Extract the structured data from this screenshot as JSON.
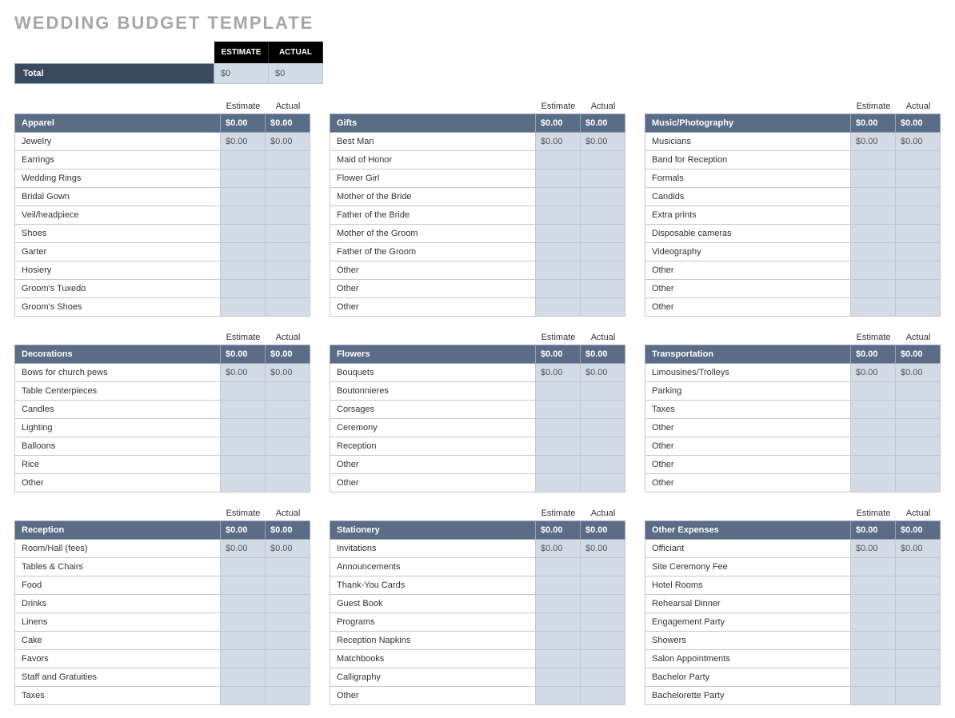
{
  "title": "WEDDING BUDGET TEMPLATE",
  "header": {
    "estimate": "ESTIMATE",
    "actual": "ACTUAL"
  },
  "total": {
    "label": "Total",
    "estimate": "$0",
    "actual": "$0"
  },
  "colLabels": {
    "estimate": "Estimate",
    "actual": "Actual"
  },
  "columns": [
    [
      {
        "name": "Apparel",
        "estimate": "$0.00",
        "actual": "$0.00",
        "items": [
          {
            "label": "Jewelry",
            "estimate": "$0.00",
            "actual": "$0.00"
          },
          {
            "label": "Earrings",
            "estimate": "",
            "actual": ""
          },
          {
            "label": "Wedding Rings",
            "estimate": "",
            "actual": ""
          },
          {
            "label": "Bridal Gown",
            "estimate": "",
            "actual": ""
          },
          {
            "label": "Veil/headpiece",
            "estimate": "",
            "actual": ""
          },
          {
            "label": "Shoes",
            "estimate": "",
            "actual": ""
          },
          {
            "label": "Garter",
            "estimate": "",
            "actual": ""
          },
          {
            "label": "Hosiery",
            "estimate": "",
            "actual": ""
          },
          {
            "label": "Groom's Tuxedo",
            "estimate": "",
            "actual": ""
          },
          {
            "label": "Groom's Shoes",
            "estimate": "",
            "actual": ""
          }
        ]
      },
      {
        "name": "Decorations",
        "estimate": "$0.00",
        "actual": "$0.00",
        "items": [
          {
            "label": "Bows for church pews",
            "estimate": "$0.00",
            "actual": "$0.00"
          },
          {
            "label": "Table Centerpieces",
            "estimate": "",
            "actual": ""
          },
          {
            "label": "Candles",
            "estimate": "",
            "actual": ""
          },
          {
            "label": "Lighting",
            "estimate": "",
            "actual": ""
          },
          {
            "label": "Balloons",
            "estimate": "",
            "actual": ""
          },
          {
            "label": "Rice",
            "estimate": "",
            "actual": ""
          },
          {
            "label": "Other",
            "estimate": "",
            "actual": ""
          }
        ]
      },
      {
        "name": "Reception",
        "estimate": "$0.00",
        "actual": "$0.00",
        "items": [
          {
            "label": "Room/Hall (fees)",
            "estimate": "$0.00",
            "actual": "$0.00"
          },
          {
            "label": "Tables & Chairs",
            "estimate": "",
            "actual": ""
          },
          {
            "label": "Food",
            "estimate": "",
            "actual": ""
          },
          {
            "label": "Drinks",
            "estimate": "",
            "actual": ""
          },
          {
            "label": "Linens",
            "estimate": "",
            "actual": ""
          },
          {
            "label": "Cake",
            "estimate": "",
            "actual": ""
          },
          {
            "label": "Favors",
            "estimate": "",
            "actual": ""
          },
          {
            "label": "Staff and Gratuities",
            "estimate": "",
            "actual": ""
          },
          {
            "label": "Taxes",
            "estimate": "",
            "actual": ""
          }
        ]
      }
    ],
    [
      {
        "name": "Gifts",
        "estimate": "$0.00",
        "actual": "$0.00",
        "items": [
          {
            "label": "Best Man",
            "estimate": "$0.00",
            "actual": "$0.00"
          },
          {
            "label": "Maid of Honor",
            "estimate": "",
            "actual": ""
          },
          {
            "label": "Flower Girl",
            "estimate": "",
            "actual": ""
          },
          {
            "label": "Mother of the Bride",
            "estimate": "",
            "actual": ""
          },
          {
            "label": "Father of the Bride",
            "estimate": "",
            "actual": ""
          },
          {
            "label": "Mother of the Groom",
            "estimate": "",
            "actual": ""
          },
          {
            "label": "Father of the Groom",
            "estimate": "",
            "actual": ""
          },
          {
            "label": "Other",
            "estimate": "",
            "actual": ""
          },
          {
            "label": "Other",
            "estimate": "",
            "actual": ""
          },
          {
            "label": "Other",
            "estimate": "",
            "actual": ""
          }
        ]
      },
      {
        "name": "Flowers",
        "estimate": "$0.00",
        "actual": "$0.00",
        "items": [
          {
            "label": "Bouquets",
            "estimate": "$0.00",
            "actual": "$0.00"
          },
          {
            "label": "Boutonnieres",
            "estimate": "",
            "actual": ""
          },
          {
            "label": "Corsages",
            "estimate": "",
            "actual": ""
          },
          {
            "label": "Ceremony",
            "estimate": "",
            "actual": ""
          },
          {
            "label": "Reception",
            "estimate": "",
            "actual": ""
          },
          {
            "label": "Other",
            "estimate": "",
            "actual": ""
          },
          {
            "label": "Other",
            "estimate": "",
            "actual": ""
          }
        ]
      },
      {
        "name": "Stationery",
        "estimate": "$0.00",
        "actual": "$0.00",
        "items": [
          {
            "label": "Invitations",
            "estimate": "$0.00",
            "actual": "$0.00"
          },
          {
            "label": "Announcements",
            "estimate": "",
            "actual": ""
          },
          {
            "label": "Thank-You Cards",
            "estimate": "",
            "actual": ""
          },
          {
            "label": "Guest Book",
            "estimate": "",
            "actual": ""
          },
          {
            "label": "Programs",
            "estimate": "",
            "actual": ""
          },
          {
            "label": "Reception Napkins",
            "estimate": "",
            "actual": ""
          },
          {
            "label": "Matchbooks",
            "estimate": "",
            "actual": ""
          },
          {
            "label": "Calligraphy",
            "estimate": "",
            "actual": ""
          },
          {
            "label": "Other",
            "estimate": "",
            "actual": ""
          }
        ]
      }
    ],
    [
      {
        "name": "Music/Photography",
        "estimate": "$0.00",
        "actual": "$0.00",
        "items": [
          {
            "label": "Musicians",
            "estimate": "$0.00",
            "actual": "$0.00"
          },
          {
            "label": "Band for Reception",
            "estimate": "",
            "actual": ""
          },
          {
            "label": "Formals",
            "estimate": "",
            "actual": ""
          },
          {
            "label": "Candids",
            "estimate": "",
            "actual": ""
          },
          {
            "label": "Extra prints",
            "estimate": "",
            "actual": ""
          },
          {
            "label": "Disposable cameras",
            "estimate": "",
            "actual": ""
          },
          {
            "label": "Videography",
            "estimate": "",
            "actual": ""
          },
          {
            "label": "Other",
            "estimate": "",
            "actual": ""
          },
          {
            "label": "Other",
            "estimate": "",
            "actual": ""
          },
          {
            "label": "Other",
            "estimate": "",
            "actual": ""
          }
        ]
      },
      {
        "name": "Transportation",
        "estimate": "$0.00",
        "actual": "$0.00",
        "items": [
          {
            "label": "Limousines/Trolleys",
            "estimate": "$0.00",
            "actual": "$0.00"
          },
          {
            "label": "Parking",
            "estimate": "",
            "actual": ""
          },
          {
            "label": "Taxes",
            "estimate": "",
            "actual": ""
          },
          {
            "label": "Other",
            "estimate": "",
            "actual": ""
          },
          {
            "label": "Other",
            "estimate": "",
            "actual": ""
          },
          {
            "label": "Other",
            "estimate": "",
            "actual": ""
          },
          {
            "label": "Other",
            "estimate": "",
            "actual": ""
          }
        ]
      },
      {
        "name": "Other Expenses",
        "estimate": "$0.00",
        "actual": "$0.00",
        "items": [
          {
            "label": "Officiant",
            "estimate": "$0.00",
            "actual": "$0.00"
          },
          {
            "label": "Site Ceremony Fee",
            "estimate": "",
            "actual": ""
          },
          {
            "label": "Hotel Rooms",
            "estimate": "",
            "actual": ""
          },
          {
            "label": "Rehearsal Dinner",
            "estimate": "",
            "actual": ""
          },
          {
            "label": "Engagement Party",
            "estimate": "",
            "actual": ""
          },
          {
            "label": "Showers",
            "estimate": "",
            "actual": ""
          },
          {
            "label": "Salon Appointments",
            "estimate": "",
            "actual": ""
          },
          {
            "label": "Bachelor Party",
            "estimate": "",
            "actual": ""
          },
          {
            "label": "Bachelorette Party",
            "estimate": "",
            "actual": ""
          }
        ]
      }
    ]
  ]
}
